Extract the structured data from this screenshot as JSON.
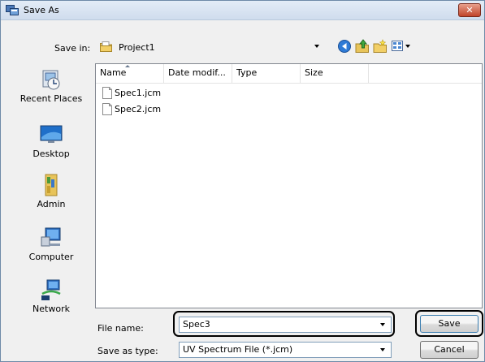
{
  "window": {
    "title": "Save As",
    "close_label": "✕"
  },
  "toolbar": {
    "save_in_label": "Save in:",
    "location": "Project1",
    "icons": [
      "back-icon",
      "up-folder-icon",
      "new-folder-icon",
      "views-menu-icon"
    ]
  },
  "places": [
    {
      "label": "Recent Places",
      "icon": "recent-places-icon"
    },
    {
      "label": "Desktop",
      "icon": "desktop-icon"
    },
    {
      "label": "Admin",
      "icon": "user-folder-icon"
    },
    {
      "label": "Computer",
      "icon": "computer-icon"
    },
    {
      "label": "Network",
      "icon": "network-icon"
    }
  ],
  "file_list": {
    "columns": [
      "Name",
      "Date modif...",
      "Type",
      "Size"
    ],
    "sorted_by": "Name",
    "files": [
      {
        "name": "Spec1.jcm"
      },
      {
        "name": "Spec2.jcm"
      }
    ]
  },
  "form": {
    "file_name_label": "File name:",
    "file_name_value": "Spec3",
    "save_as_type_label": "Save as type:",
    "save_as_type_value": "UV Spectrum File (*.jcm)"
  },
  "buttons": {
    "save": "Save",
    "cancel": "Cancel"
  },
  "colors": {
    "title_bar": "#cfdced",
    "close_button": "#c0442a",
    "highlight_border": "#000000"
  }
}
